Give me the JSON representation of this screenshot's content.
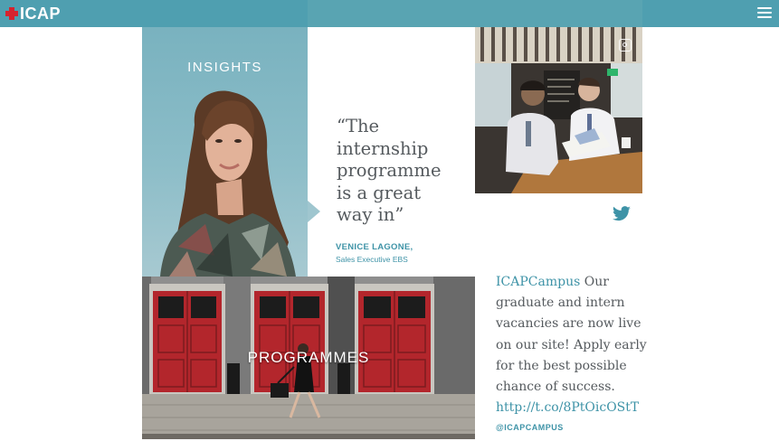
{
  "header": {
    "logo_text": "ICAP",
    "logo_mark_color": "#d6232e",
    "bar_color": "#4f9fb0",
    "menu_icon": "hamburger-menu-icon"
  },
  "insights": {
    "label": "INSIGHTS",
    "quote_lines": [
      "“The",
      "internship",
      "programme",
      "is a great",
      "way in”"
    ],
    "author_name": "VENICE LAGONE,",
    "author_role": "Sales Executive EBS"
  },
  "social": {
    "instagram_icon": "instagram-icon",
    "twitter_icon": "twitter-bird-icon"
  },
  "programmes": {
    "label": "PROGRAMMES"
  },
  "tweet": {
    "account": "ICAPCampus",
    "lines": [
      "Our",
      "graduate and intern",
      "vacancies are now live",
      "on our site! Apply early",
      "for the best possible",
      "chance of success."
    ],
    "link": "http://t.co/8PtOicOStT",
    "handle": "@ICAPCAMPUS"
  },
  "colors": {
    "accent": "#3e93a7",
    "panel_teal": "#79b2bf",
    "body_text": "#555a5e",
    "door_red": "#b3262c"
  }
}
